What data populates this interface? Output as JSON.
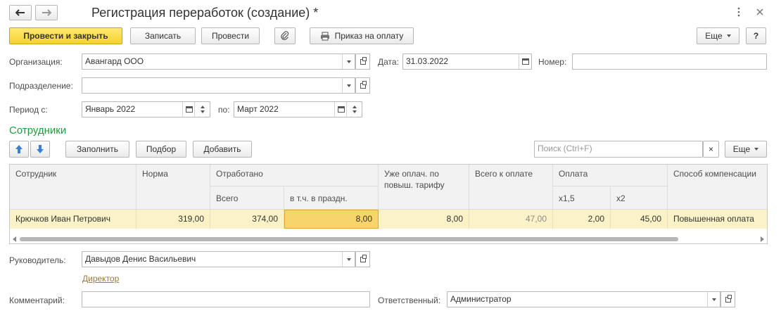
{
  "window": {
    "title": "Регистрация переработок (создание) *",
    "back_icon": "arrow-left-icon",
    "forward_icon": "arrow-right-icon",
    "menu_icon": "more-vertical-icon",
    "close_icon": "close-icon"
  },
  "toolbar": {
    "post_close_label": "Провести и закрыть",
    "save_label": "Записать",
    "post_label": "Провести",
    "print_label": "Приказ на оплату",
    "more_label": "Еще",
    "help_label": "?"
  },
  "form": {
    "org_label": "Организация:",
    "org_value": "Авангард ООО",
    "date_label": "Дата:",
    "date_value": "31.03.2022",
    "number_label": "Номер:",
    "number_value": "",
    "dept_label": "Подразделение:",
    "dept_value": "",
    "period_from_label": "Период с:",
    "period_from_value": "Январь 2022",
    "period_to_label": "по:",
    "period_to_value": "Март 2022"
  },
  "employees": {
    "section_title": "Сотрудники",
    "fill_label": "Заполнить",
    "select_label": "Подбор",
    "add_label": "Добавить",
    "search_placeholder": "Поиск (Ctrl+F)",
    "clear_label": "×",
    "more_label": "Еще",
    "columns": {
      "employee": "Сотрудник",
      "norm": "Норма",
      "worked": "Отработано",
      "worked_total": "Всего",
      "worked_holiday": "в т.ч. в праздн.",
      "already_paid": "Уже оплач. по повыш. тарифу",
      "total_to_pay": "Всего к оплате",
      "payment": "Оплата",
      "pay_x15": "х1,5",
      "pay_x2": "х2",
      "compensation": "Способ компенсации"
    },
    "rows": [
      {
        "employee": "Крючков Иван Петрович",
        "norm": "319,00",
        "worked_total": "374,00",
        "worked_holiday": "8,00",
        "already_paid": "8,00",
        "total_to_pay": "47,00",
        "pay_x15": "2,00",
        "pay_x2": "45,00",
        "compensation": "Повышенная оплата"
      }
    ]
  },
  "footer": {
    "manager_label": "Руководитель:",
    "manager_value": "Давыдов Денис Васильевич",
    "manager_position": "Директор",
    "comment_label": "Комментарий:",
    "comment_value": "",
    "responsible_label": "Ответственный:",
    "responsible_value": "Администратор"
  },
  "colors": {
    "accent_yellow": "#f6d32a",
    "section_green": "#1a9e3f",
    "selected_row": "#fbf2c7",
    "active_cell": "#f8d56a",
    "link": "#9a7b3f"
  }
}
